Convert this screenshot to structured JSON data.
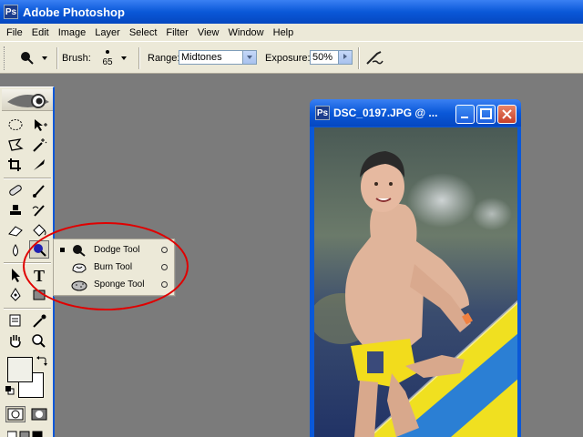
{
  "app": {
    "title": "Adobe Photoshop",
    "icon": "photoshop-app-icon"
  },
  "menu": [
    "File",
    "Edit",
    "Image",
    "Layer",
    "Select",
    "Filter",
    "View",
    "Window",
    "Help"
  ],
  "options": {
    "brush_label": "Brush:",
    "brush_size": "65",
    "range_label": "Range:",
    "range_value": "Midtones",
    "exposure_label": "Exposure:",
    "exposure_value": "50%"
  },
  "flyout": {
    "items": [
      {
        "label": "Dodge Tool",
        "selected": true,
        "icon": "dodge-tool-icon"
      },
      {
        "label": "Burn Tool",
        "selected": false,
        "icon": "burn-tool-icon"
      },
      {
        "label": "Sponge Tool",
        "selected": false,
        "icon": "sponge-tool-icon"
      }
    ]
  },
  "document": {
    "title": "DSC_0197.JPG @ ..."
  },
  "colors": {
    "xp_blue": "#0a58d8",
    "highlight": "#e00000",
    "panel": "#ece9d8",
    "workspace": "#7b7b7b",
    "foreground": "#f0f0e8",
    "background": "#ffffff"
  }
}
